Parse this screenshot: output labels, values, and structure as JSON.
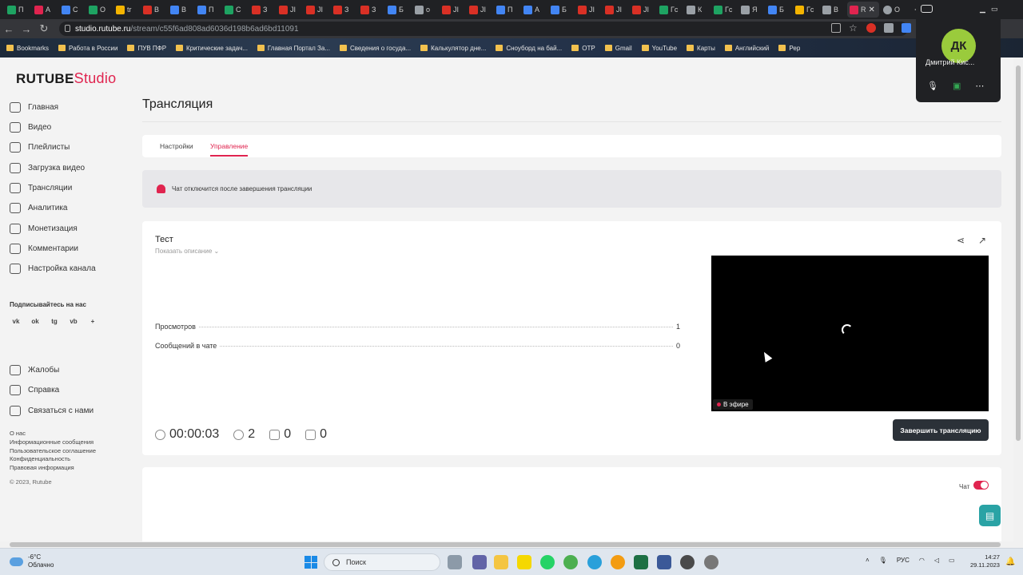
{
  "browser": {
    "tabs": [
      {
        "label": "П",
        "color": "#1ea362"
      },
      {
        "label": "А",
        "color": "#e0244f"
      },
      {
        "label": "С",
        "color": "#4285f4"
      },
      {
        "label": "О",
        "color": "#1ea362"
      },
      {
        "label": "tr",
        "color": "#f4b400"
      },
      {
        "label": "В",
        "color": "#d93025"
      },
      {
        "label": "В",
        "color": "#4285f4"
      },
      {
        "label": "П",
        "color": "#4285f4"
      },
      {
        "label": "С",
        "color": "#1ea362"
      },
      {
        "label": "З",
        "color": "#d93025"
      },
      {
        "label": "JI",
        "color": "#d93025"
      },
      {
        "label": "JI",
        "color": "#d93025"
      },
      {
        "label": "З",
        "color": "#d93025"
      },
      {
        "label": "З",
        "color": "#d93025"
      },
      {
        "label": "Б",
        "color": "#4285f4"
      },
      {
        "label": "о",
        "color": "#9aa0a6"
      },
      {
        "label": "JI",
        "color": "#d93025"
      },
      {
        "label": "JI",
        "color": "#d93025"
      },
      {
        "label": "П",
        "color": "#4285f4"
      },
      {
        "label": "А",
        "color": "#4285f4"
      },
      {
        "label": "Б",
        "color": "#4285f4"
      },
      {
        "label": "JI",
        "color": "#d93025"
      },
      {
        "label": "JI",
        "color": "#d93025"
      },
      {
        "label": "JI",
        "color": "#d93025"
      },
      {
        "label": "Гс",
        "color": "#1ea362"
      },
      {
        "label": "К",
        "color": "#9aa0a6"
      },
      {
        "label": "Гс",
        "color": "#1ea362"
      },
      {
        "label": "Я",
        "color": "#9aa0a6"
      },
      {
        "label": "Б",
        "color": "#4285f4"
      },
      {
        "label": "Гс",
        "color": "#f4b400"
      },
      {
        "label": "В",
        "color": "#9aa0a6"
      }
    ],
    "active_tab": {
      "label": "R",
      "close": "✕"
    },
    "last_tab": {
      "label": "О"
    },
    "new_tab": "+",
    "url_host": "studio.rutube.ru",
    "url_path": "/stream/c55f6ad808ad6036d198b6ad6bd11091",
    "bookmarks": [
      "Bookmarks",
      "Работа в России",
      "ПУВ ПФР",
      "Критические задач...",
      "Главная Портал За...",
      "Сведения о госуда...",
      "Калькулятор дне...",
      "Сноуборд на бай...",
      "ОТР",
      "Gmail",
      "YouTube",
      "Карты",
      "Английский",
      "Рер"
    ]
  },
  "logo": {
    "brand": "RUTUBE",
    "product": "Studio"
  },
  "sidebar": {
    "items": [
      "Главная",
      "Видео",
      "Плейлисты",
      "Загрузка видео",
      "Трансляции",
      "Аналитика",
      "Монетизация",
      "Комментарии",
      "Настройка канала"
    ],
    "subscribe_title": "Подписывайтесь на нас",
    "socials": [
      "vk",
      "ok",
      "tg",
      "vb",
      "+"
    ],
    "bottom_items": [
      "Жалобы",
      "Справка",
      "Связаться с нами"
    ],
    "footer_links": [
      "О нас",
      "Информационные сообщения",
      "Пользовательское соглашение",
      "Конфиденциальность",
      "Правовая информация"
    ],
    "copyright": "© 2023, Rutube"
  },
  "main": {
    "title": "Трансляция",
    "tabs": [
      "Настройки",
      "Управление"
    ],
    "active_tab": "Управление",
    "notice": "Чат отключится после завершения трансляции",
    "stream": {
      "name": "Тест",
      "show_description": "Показать описание",
      "stats": [
        {
          "label": "Просмотров",
          "value": "1"
        },
        {
          "label": "Сообщений в чате",
          "value": "0"
        }
      ],
      "live_badge": "В эфире",
      "duration": "00:00:03",
      "viewers": "2",
      "likes": "0",
      "dislikes": "0",
      "end_button": "Завершить трансляцию"
    },
    "chat": {
      "label": "Чат",
      "enabled": true
    }
  },
  "meet": {
    "initials": "ДК",
    "name": "Дмитрий Кис..."
  },
  "taskbar": {
    "temperature": "-6°C",
    "condition": "Облачно",
    "search_placeholder": "Поиск",
    "language": "РУС",
    "time": "14:27",
    "date": "29.11.2023"
  },
  "colors": {
    "accent": "#e0244f",
    "dark_button": "#2b3138",
    "chat_fab": "#2aa3a5"
  }
}
